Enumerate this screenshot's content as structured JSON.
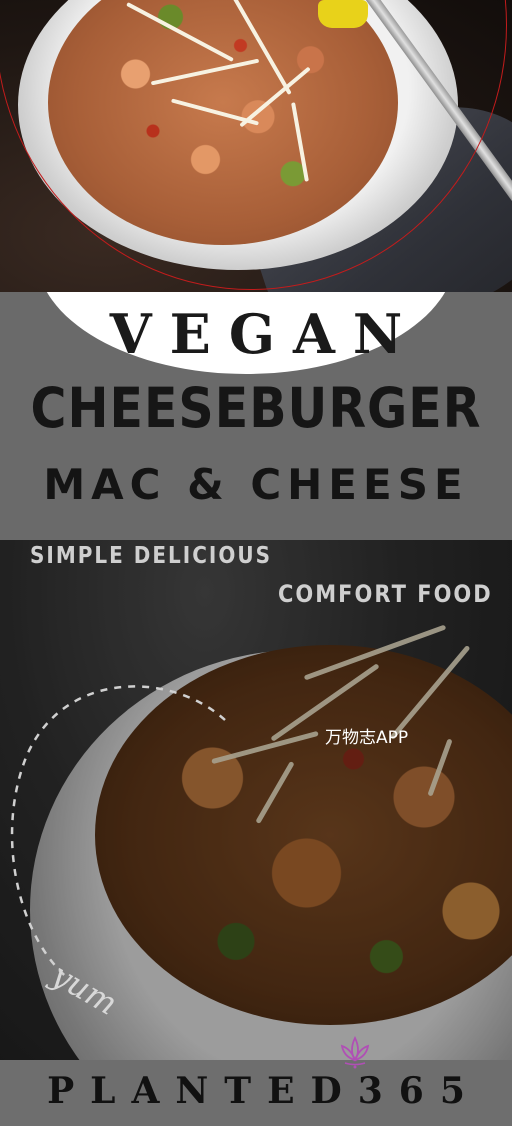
{
  "title_block": {
    "line1": "VEGAN",
    "line2": "CHEESEBURGER",
    "line3": "MAC & CHEESE"
  },
  "captions": {
    "simple": "SIMPLE DELICIOUS",
    "comfort": "COMFORT FOOD",
    "yum": "yum"
  },
  "watermark": "万物志APP",
  "brand": "PLANTED365",
  "icons": {
    "logo": "lotus-logo"
  },
  "colors": {
    "band_gray": "#6a6a6a",
    "accent_ring": "#c21c1c",
    "lotus": "#b04fb5"
  }
}
